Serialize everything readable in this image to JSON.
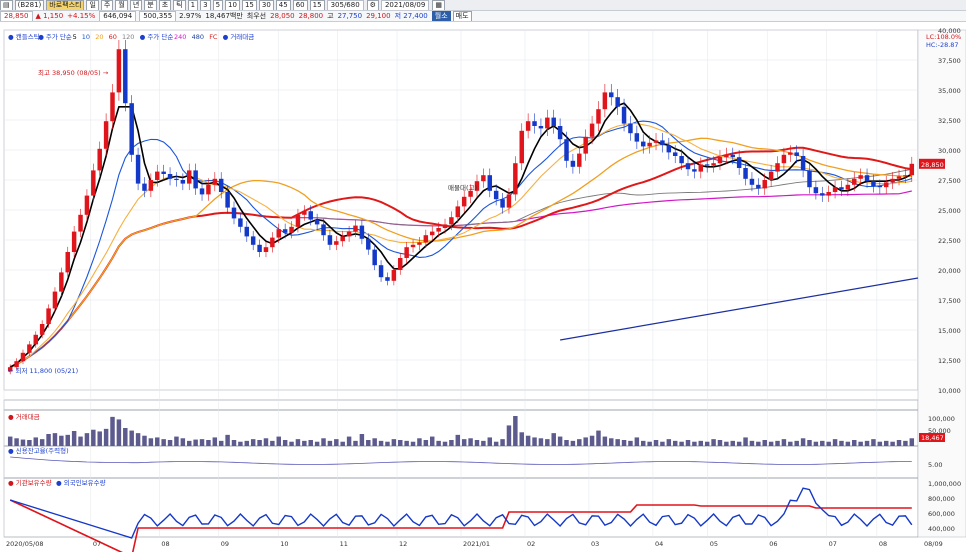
{
  "toolbar": {
    "code": "(B281)",
    "name": "바로팩스티",
    "controls": [
      "일",
      "주",
      "월",
      "년",
      "분",
      "초",
      "틱"
    ],
    "periods": [
      "1",
      "3",
      "5",
      "10",
      "15",
      "30",
      "45",
      "60",
      "15"
    ],
    "count": "305",
    "count_total": "680",
    "date": "2021/08/09",
    "btn_view": "월소",
    "btn_sell": "매도"
  },
  "quote": {
    "price": "28,850",
    "change": "▲ 1,150",
    "pct": "+4.15%",
    "volume": "646,094",
    "volume_prev": "500,355",
    "ratio": "2.97%",
    "amount": "18,467백만",
    "kind": "최우선",
    "open": "28,050",
    "high": "28,800",
    "low_label": "고",
    "low": "27,750",
    "close": "29,100",
    "etc": "저 27,400"
  },
  "chart_data": {
    "type": "line",
    "price_panel": {
      "legend": [
        {
          "text": "● 캔들스틱",
          "color": "#1c3fcf"
        },
        {
          "text": "● 주가 단순",
          "color": "#1c3fcf"
        },
        {
          "text": "5",
          "color": "#000000"
        },
        {
          "text": "10",
          "color": "#1c56d8"
        },
        {
          "text": "20",
          "color": "#f0a020"
        },
        {
          "text": "60",
          "color": "#d81818"
        },
        {
          "text": "120",
          "color": "#808080"
        },
        {
          "text": "● 주가 단순",
          "color": "#1c3fcf"
        },
        {
          "text": "240",
          "color": "#d018c8"
        },
        {
          "text": "480",
          "color": "#1c3fa0"
        },
        {
          "text": "FC",
          "color": "#d81818"
        },
        {
          "text": "● 거래대금",
          "color": "#1c3fcf"
        }
      ],
      "ylim": [
        10000,
        40000
      ],
      "y_ticks": [
        "10,000",
        "12,500",
        "15,000",
        "17,500",
        "20,000",
        "22,500",
        "25,000",
        "27,500",
        "30,000",
        "32,500",
        "35,000",
        "37,500",
        "40,000"
      ],
      "current_label": "28,850",
      "corner_top": "LC:108.0%",
      "corner_sub": "HC:-28.87",
      "annot_high": "최고 38,950 (08/05) →",
      "annot_low": "← 최저 11,800 (05/21)",
      "annot_mid": "매물대(고)",
      "candles_x_start": "2020/05/08",
      "closes": [
        11900,
        12400,
        13100,
        13800,
        14600,
        15500,
        16800,
        18200,
        19800,
        21500,
        23200,
        24600,
        26200,
        28300,
        30100,
        32400,
        34800,
        38400,
        33900,
        29600,
        27200,
        26600,
        27500,
        28200,
        28000,
        27600,
        27500,
        27200,
        28300,
        26800,
        26300,
        27100,
        27600,
        26500,
        25200,
        24300,
        23600,
        22800,
        22100,
        21500,
        21900,
        22700,
        23400,
        23100,
        23600,
        24600,
        24900,
        24200,
        23800,
        22900,
        22100,
        22400,
        22800,
        23200,
        23700,
        22600,
        21700,
        20400,
        19400,
        19100,
        20000,
        21000,
        21900,
        22100,
        22300,
        22900,
        23200,
        23500,
        23800,
        24400,
        25300,
        26100,
        26600,
        27400,
        27900,
        26600,
        25900,
        25200,
        26300,
        28900,
        31600,
        32400,
        32000,
        31800,
        32700,
        32000,
        30900,
        29100,
        28600,
        29700,
        31100,
        32200,
        33400,
        34800,
        34400,
        33600,
        32200,
        31400,
        30700,
        30300,
        30600,
        30800,
        30400,
        29800,
        29500,
        28900,
        28400,
        28200,
        28800,
        28700,
        28900,
        29400,
        29600,
        29400,
        28500,
        27600,
        27100,
        26800,
        27500,
        28200,
        28900,
        29600,
        29800,
        29500,
        28300,
        26900,
        26400,
        26200,
        26500,
        26900,
        26700,
        27100,
        27600,
        27900,
        27400,
        27000,
        26900,
        27300,
        27600,
        27800,
        27900,
        28850
      ],
      "ma5": [
        11900,
        12200,
        12700,
        13200,
        13900,
        14600,
        15500,
        16600,
        17800,
        19200,
        20900,
        22300,
        24000,
        25900,
        27600,
        29500,
        31800,
        33600,
        33600,
        33600,
        31600,
        28900,
        27300,
        27300,
        27500,
        27700,
        27800,
        27700,
        27900,
        27500,
        27200,
        27200,
        27300,
        27000,
        26700,
        26000,
        25100,
        24300,
        23600,
        22900,
        22400,
        22200,
        22500,
        22800,
        23100,
        23500,
        23800,
        24000,
        24200,
        24100,
        23600,
        23100,
        22800,
        22900,
        23000,
        22900,
        22600,
        22100,
        21500,
        20700,
        20100,
        20100,
        20500,
        21000,
        21500,
        22000,
        22400,
        22900,
        23200,
        23600,
        24100,
        24700,
        25300,
        26000,
        26600,
        26900,
        27000,
        26700,
        26400,
        26600,
        27600,
        28900,
        30100,
        31100,
        31700,
        32000,
        31600,
        31100,
        30500,
        30200,
        30300,
        30700,
        31300,
        32400,
        33100,
        33700,
        33900,
        33300,
        32500,
        31500,
        31000,
        30700,
        30500,
        30400,
        30100,
        29900,
        29400,
        29000,
        28700,
        28600,
        28600,
        28700,
        28900,
        29100,
        29200,
        29000,
        28600,
        28200,
        27800,
        27500,
        27600,
        28000,
        28500,
        29100,
        29200,
        28900,
        28400,
        27800,
        27300,
        26900,
        26600,
        26600,
        26800,
        27200,
        27400,
        27400,
        27400,
        27400,
        27500,
        27500,
        27700,
        28000
      ],
      "ma20": [
        11900,
        12100,
        12500,
        12800,
        13300,
        13800,
        14300,
        14900,
        15600,
        16400,
        17100,
        17900,
        18700,
        19600,
        20500,
        21400,
        22400,
        23400,
        24300,
        25100,
        25900,
        26400,
        26900,
        27300,
        27600,
        27800,
        27800,
        27800,
        27800,
        27700,
        27500,
        27200,
        27100,
        27000,
        26900,
        26700,
        26500,
        26200,
        25900,
        25600,
        25300,
        24900,
        24500,
        24100,
        23800,
        23600,
        23400,
        23400,
        23300,
        23300,
        23300,
        23200,
        23200,
        23200,
        23200,
        23100,
        23000,
        22900,
        22700,
        22500,
        22400,
        22300,
        22300,
        22300,
        22300,
        22300,
        22400,
        22500,
        22600,
        22700,
        22900,
        23100,
        23400,
        23700,
        24000,
        24300,
        24500,
        24800,
        25100,
        25500,
        26000,
        26600,
        27200,
        27800,
        28300,
        28800,
        29300,
        29700,
        30000,
        30300,
        30600,
        30900,
        31200,
        31500,
        31800,
        32000,
        32100,
        32200,
        32200,
        32100,
        32000,
        31800,
        31600,
        31400,
        31200,
        30900,
        30700,
        30400,
        30100,
        29900,
        29700,
        29500,
        29400,
        29300,
        29200,
        29100,
        29000,
        28900,
        28800,
        28700,
        28600,
        28600,
        28600,
        28600,
        28500,
        28400,
        28300,
        28100,
        27900,
        27700,
        27600,
        27500,
        27400,
        27300,
        27300,
        27200,
        27200,
        27200,
        27200,
        27300,
        27300,
        27400
      ]
    },
    "volume_panel": {
      "legend": "● 거래대금",
      "ticks": [
        "100,000",
        "50,000"
      ],
      "current_label": "18,467",
      "values": [
        22,
        18,
        15,
        14,
        20,
        16,
        28,
        30,
        24,
        26,
        35,
        22,
        30,
        38,
        34,
        40,
        68,
        62,
        42,
        36,
        30,
        24,
        18,
        20,
        16,
        14,
        22,
        18,
        12,
        15,
        16,
        14,
        20,
        12,
        26,
        14,
        10,
        12,
        16,
        14,
        18,
        12,
        22,
        14,
        10,
        16,
        12,
        14,
        10,
        18,
        12,
        16,
        10,
        22,
        12,
        28,
        14,
        18,
        12,
        10,
        16,
        14,
        12,
        10,
        18,
        14,
        22,
        12,
        10,
        14,
        26,
        16,
        18,
        14,
        12,
        20,
        10,
        16,
        48,
        70,
        32,
        24,
        20,
        18,
        16,
        30,
        22,
        14,
        12,
        16,
        20,
        24,
        36,
        22,
        18,
        16,
        14,
        12,
        20,
        12,
        10,
        14,
        10,
        16,
        12,
        10,
        14,
        10,
        12,
        10,
        16,
        14,
        10,
        12,
        10,
        20,
        12,
        10,
        14,
        10,
        12,
        16,
        10,
        12,
        18,
        14,
        10,
        12,
        10,
        16,
        12,
        10,
        14,
        10,
        12,
        16,
        10,
        12,
        10,
        14,
        12,
        18
      ]
    },
    "credit_panel": {
      "legend": "● 신용잔고율(주력형)",
      "ticks": [
        "5.00"
      ]
    },
    "foreign_panel": {
      "legend_a": "● 기관보유수량",
      "legend_b": "● 외국인보유수량",
      "ticks": [
        "1,000,000",
        "800,000",
        "600,000",
        "400,000"
      ]
    },
    "x_ticks": [
      "2020/05/08",
      "07",
      "08",
      "09",
      "10",
      "11",
      "12",
      "2021/01",
      "02",
      "03",
      "04",
      "05",
      "06",
      "07",
      "08"
    ],
    "x_end": "08/09"
  }
}
